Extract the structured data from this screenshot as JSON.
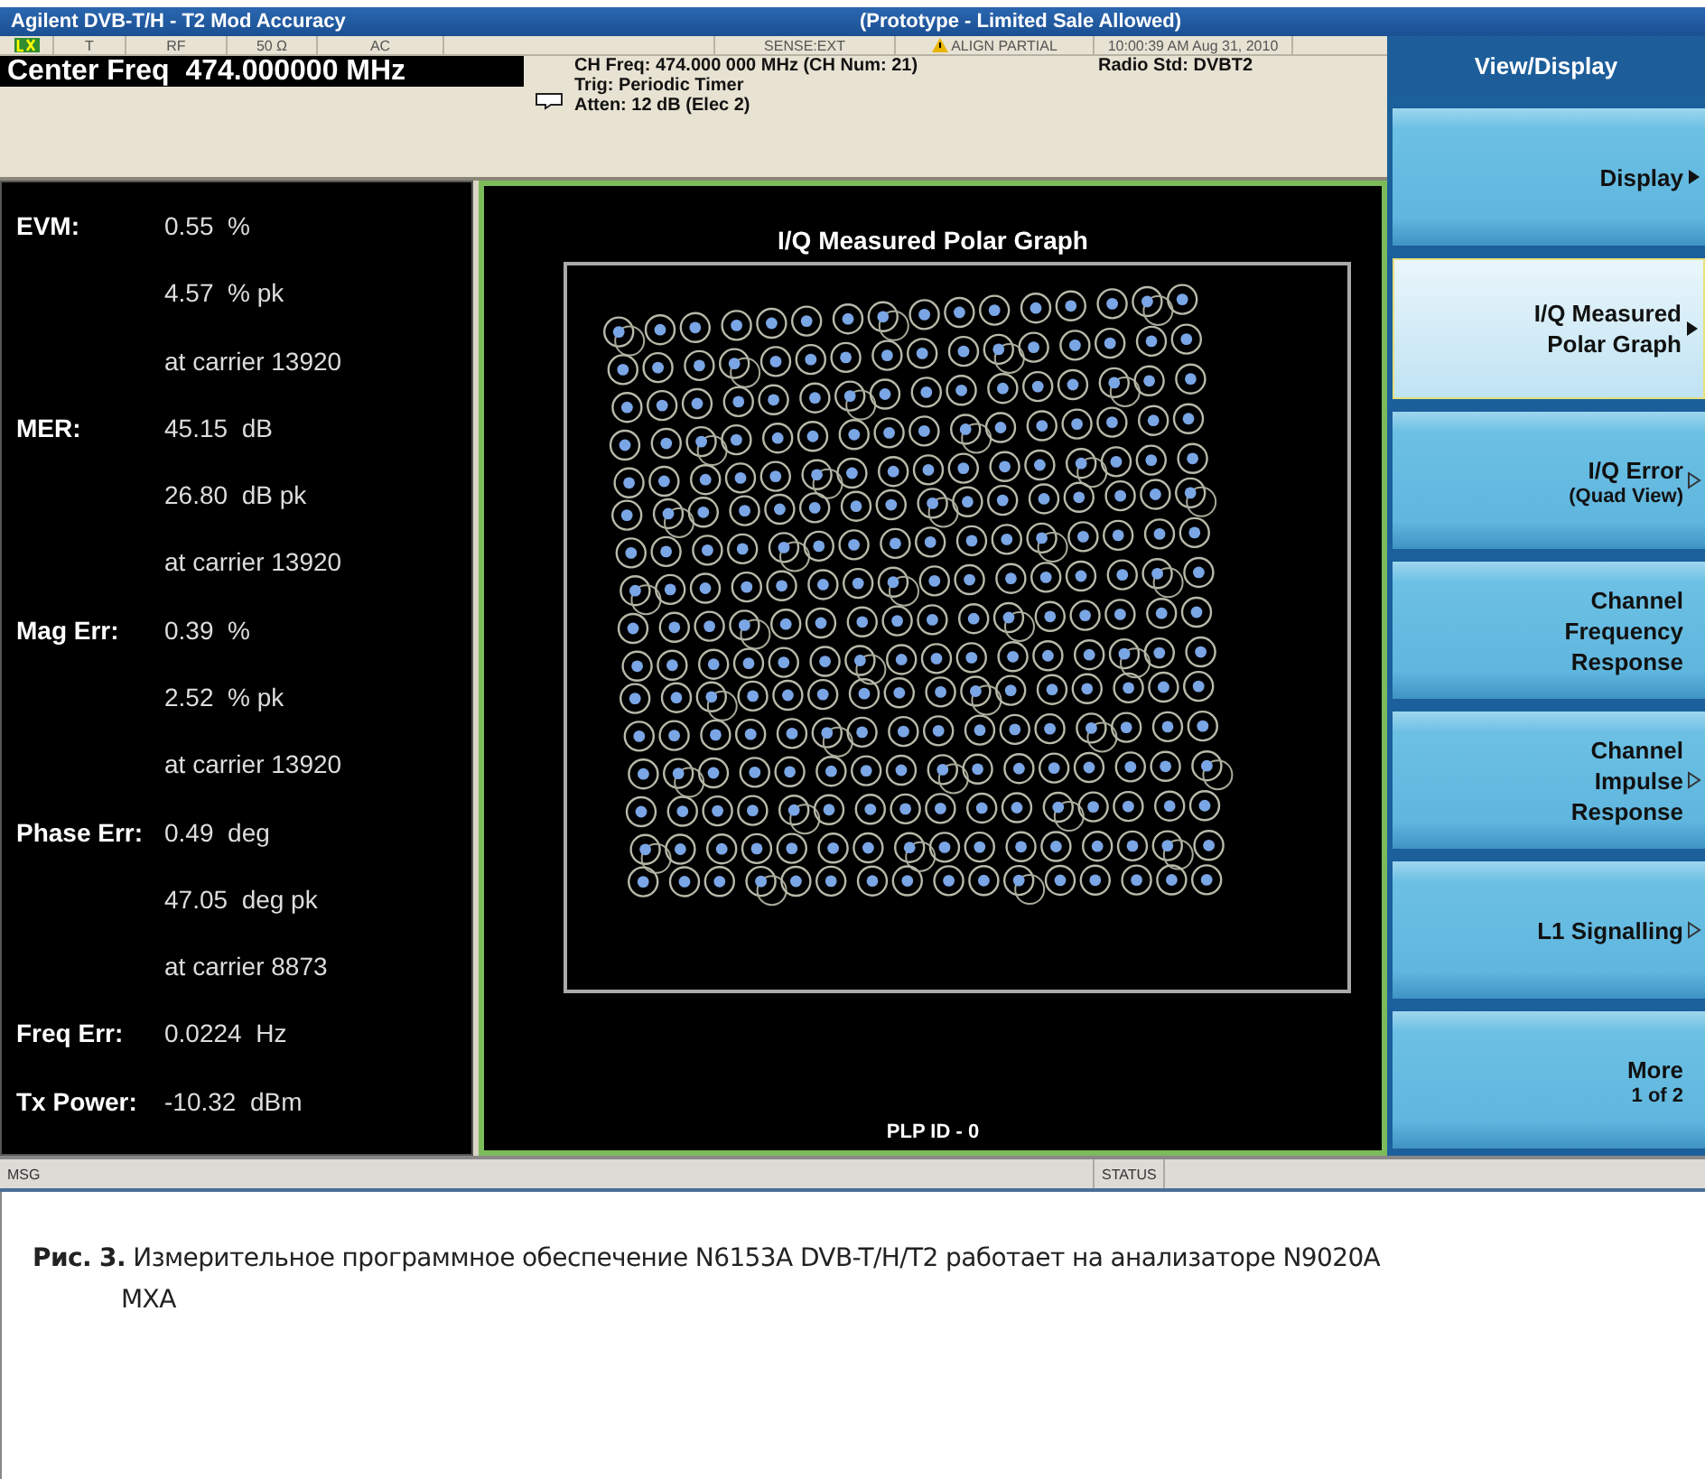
{
  "window": {
    "title": "Agilent DVB-T/H - T2 Mod Accuracy",
    "notice": "(Prototype - Limited Sale Allowed)"
  },
  "info_bar": {
    "segments": [
      {
        "kind": "lxi"
      },
      {
        "kind": "text",
        "text": "T"
      },
      {
        "kind": "text",
        "text": "RF"
      },
      {
        "kind": "text",
        "text": "50 Ω"
      },
      {
        "kind": "text",
        "text": "AC"
      },
      {
        "kind": "blank"
      },
      {
        "kind": "text",
        "text": "SENSE:EXT"
      },
      {
        "kind": "warning",
        "text": "ALIGN PARTIAL"
      },
      {
        "kind": "text",
        "text": "10:00:39 AM Aug 31, 2010"
      }
    ]
  },
  "header": {
    "center_freq": "Center Freq  474.000000 MHz",
    "lines": [
      "CH Freq: 474.000 000 MHz (CH Num: 21)",
      "Trig: Periodic Timer",
      "Atten: 12 dB (Elec 2)"
    ],
    "radio_std": "Radio Std: DVBT2"
  },
  "results": [
    {
      "label": "EVM:",
      "value": "0.55",
      "unit": "%"
    },
    {
      "value": "4.57",
      "unit": "% pk"
    },
    {
      "note": "at carrier 13920"
    },
    {
      "label": "MER:",
      "value": "45.15",
      "unit": "dB"
    },
    {
      "value": "26.80",
      "unit": "dB pk"
    },
    {
      "note": "at carrier 13920"
    },
    {
      "label": "Mag Err:",
      "value": "0.39",
      "unit": "%"
    },
    {
      "value": "2.52",
      "unit": "% pk"
    },
    {
      "note": "at carrier 13920"
    },
    {
      "label": "Phase Err:",
      "value": "0.49",
      "unit": "deg"
    },
    {
      "value": "47.05",
      "unit": "deg pk"
    },
    {
      "note": "at carrier 8873"
    },
    {
      "label": "Freq Err:",
      "value": "0.0224",
      "unit": "Hz"
    },
    {
      "label": "Tx Power:",
      "value": "-10.32",
      "unit": "dBm"
    }
  ],
  "graph": {
    "title": "I/Q Measured Polar Graph",
    "footer": "PLP ID - 0"
  },
  "softkeys": {
    "title": "View/Display",
    "keys": [
      {
        "label": [
          "Display"
        ],
        "kind": "submenu",
        "selected": false
      },
      {
        "label": [
          "I/Q Measured",
          "Polar Graph"
        ],
        "kind": "submenu",
        "selected": true
      },
      {
        "label": [
          "I/Q Error"
        ],
        "sub": "(Quad View)",
        "kind": "view",
        "selected": false
      },
      {
        "label": [
          "Channel",
          "Frequency",
          "Response"
        ],
        "kind": "plain",
        "selected": false
      },
      {
        "label": [
          "Channel",
          "Impulse",
          "Response"
        ],
        "kind": "view",
        "selected": false
      },
      {
        "label": [
          "L1 Signalling"
        ],
        "kind": "view",
        "selected": false
      },
      {
        "label": [
          "More"
        ],
        "sub": "1 of 2",
        "kind": "plain",
        "selected": false
      }
    ]
  },
  "status_bar": {
    "msg": "MSG",
    "status": "STATUS"
  },
  "caption": "**Рис. 3.** Измерительное программное обеспечение N6153A DVB-T/H/T2 работает на анализаторе N9020A MXA"
}
